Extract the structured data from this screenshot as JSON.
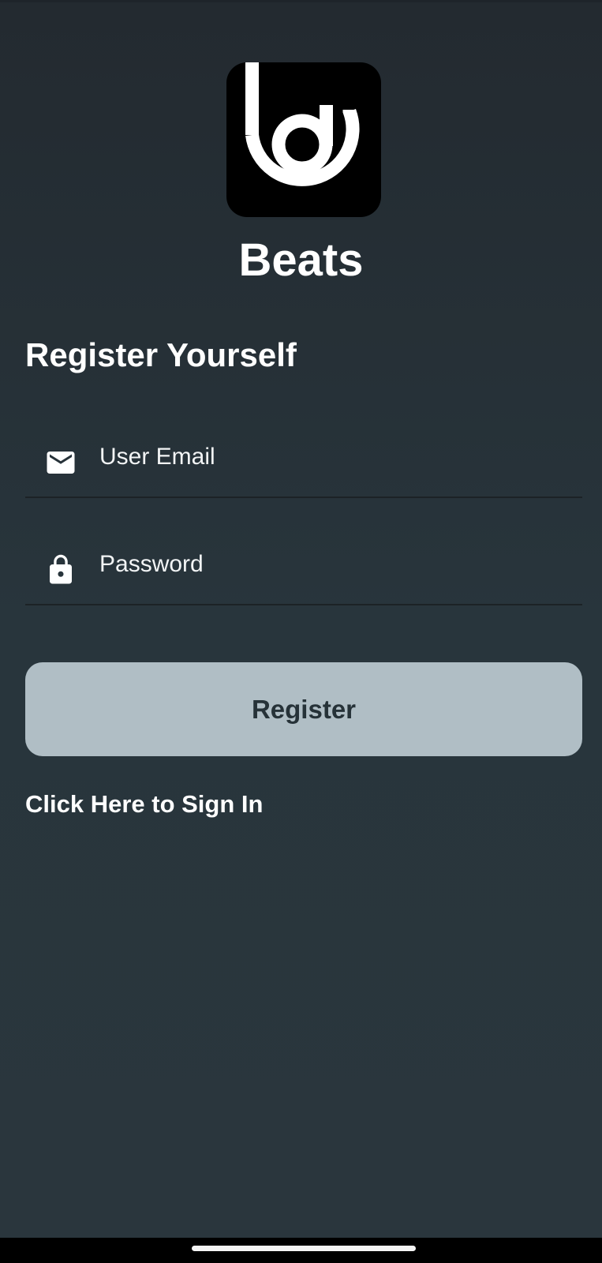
{
  "app": {
    "name": "Beats",
    "logo_icon": "beats-logo"
  },
  "form": {
    "title": "Register Yourself",
    "email": {
      "placeholder": "User Email",
      "value": "",
      "icon": "mail-icon"
    },
    "password": {
      "placeholder": "Password",
      "value": "",
      "icon": "lock-icon"
    },
    "submit_label": "Register",
    "signin_link": "Click Here to Sign In"
  },
  "colors": {
    "background_top": "#232a30",
    "background_bottom": "#2a363d",
    "button_bg": "#b0bec5",
    "button_text": "#263238",
    "text": "#ffffff",
    "logo_bg": "#000000"
  }
}
